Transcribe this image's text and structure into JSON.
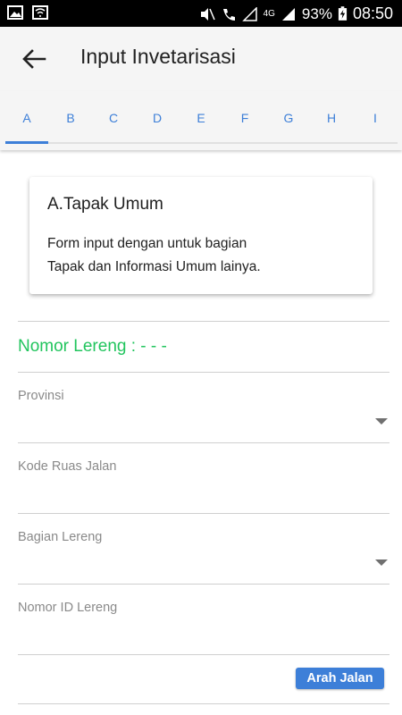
{
  "status_bar": {
    "battery": "93%",
    "time": "08:50",
    "network": "4G"
  },
  "app_bar": {
    "title": "Input Invetarisasi"
  },
  "tabs": [
    "A",
    "B",
    "C",
    "D",
    "E",
    "F",
    "G",
    "H",
    "I"
  ],
  "card": {
    "title": "A.Tapak Umum",
    "line1": "Form input dengan untuk bagian",
    "line2": "Tapak dan Informasi Umum lainya."
  },
  "form": {
    "nomor_lereng": "Nomor Lereng : - - -",
    "provinsi_label": "Provinsi",
    "kode_ruas_label": "Kode Ruas Jalan",
    "bagian_lereng_label": "Bagian Lereng",
    "nomor_id_label": "Nomor ID Lereng",
    "arah_jalan_button": "Arah Jalan"
  },
  "colors": {
    "accent": "#3d7fd8",
    "success": "#22c55e",
    "appbar": "#f5f5f5"
  }
}
